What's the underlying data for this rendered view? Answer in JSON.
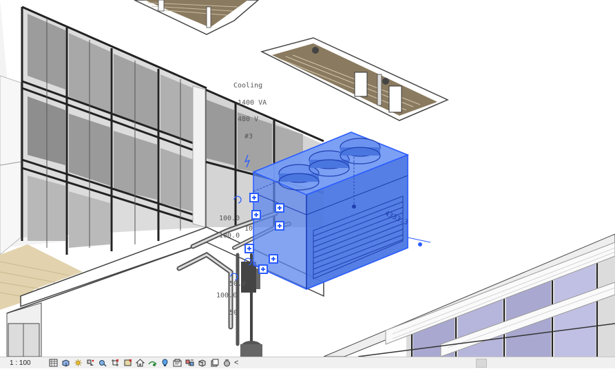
{
  "app": {
    "name": "Revit 3D view"
  },
  "tags": {
    "cooling": "Cooling",
    "va": "1400 VA",
    "voltage": "480 V",
    "circuit": "#3",
    "dim_upper": "100.0",
    "dim_upper_b": "100.0",
    "dim_mid": "10",
    "dim_lower_a": "50.0",
    "dim_lower_b": "100.0",
    "dim_lower_c": "50",
    "unit_dim": "4333.3"
  },
  "view_control_bar": {
    "scale": "1 : 100",
    "collapse": "<",
    "buttons": [
      {
        "name": "detail-level-icon"
      },
      {
        "name": "visual-style-icon"
      },
      {
        "name": "sun-path-icon"
      },
      {
        "name": "shadows-icon"
      },
      {
        "name": "show-rendering-icon"
      },
      {
        "name": "crop-view-icon"
      },
      {
        "name": "show-crop-region-icon"
      },
      {
        "name": "unlocked-3d-view-icon"
      },
      {
        "name": "temporary-hide-isolate-icon"
      },
      {
        "name": "reveal-hidden-elements-icon"
      },
      {
        "name": "temporary-view-properties-icon"
      },
      {
        "name": "worksharing-display-icon"
      },
      {
        "name": "analytical-model-icon"
      },
      {
        "name": "highlight-displacement-icon"
      },
      {
        "name": "reveal-constraints-icon"
      }
    ]
  },
  "colors": {
    "selection": "#2a5cff",
    "selection_fill": "#5b86ee",
    "window_frame": "#2a2a2a",
    "floor_wood": "#e2d3ae"
  }
}
